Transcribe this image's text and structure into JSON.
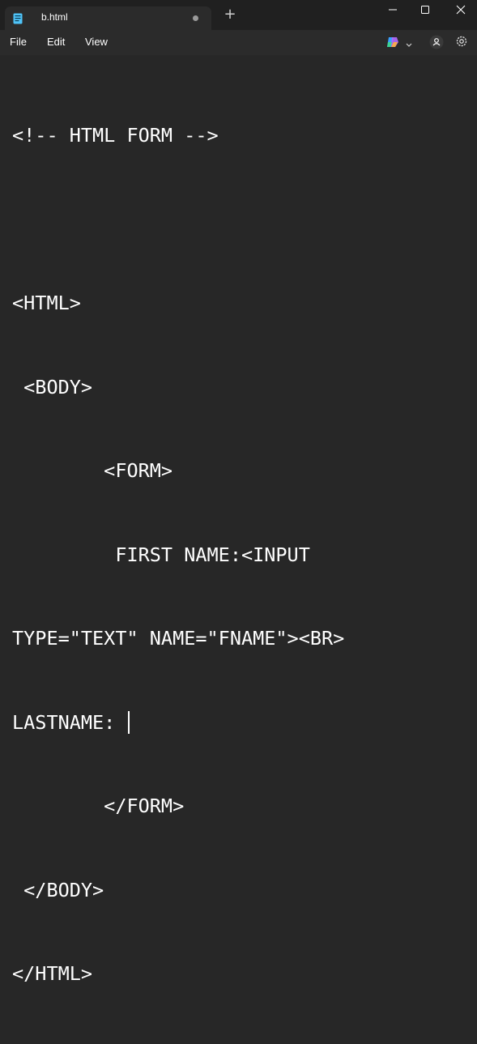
{
  "window": {
    "tab_title": "b.html",
    "new_tab_symbol": "+"
  },
  "menu": {
    "file": "File",
    "edit": "Edit",
    "view": "View"
  },
  "editor": {
    "lines": [
      "<!-- HTML FORM -->",
      "",
      "<HTML>",
      " <BODY>",
      "        <FORM>",
      "         FIRST NAME:<INPUT",
      "TYPE=\"TEXT\" NAME=\"FNAME\"><BR>",
      "LASTNAME: ",
      "        </FORM>",
      " </BODY>",
      "</HTML>"
    ],
    "caret_line": 8
  },
  "colors": {
    "titlebar": "#202020",
    "menubar": "#2b2b2b",
    "editor_bg": "#272727",
    "text": "#ffffff",
    "file_icon": "#4fc3f7"
  }
}
